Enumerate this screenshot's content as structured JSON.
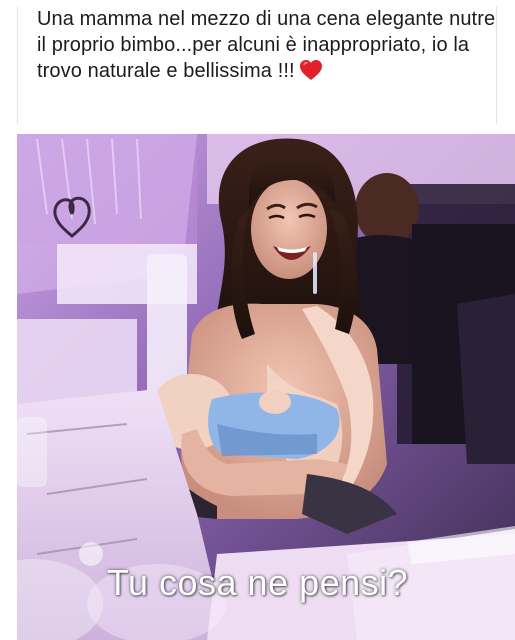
{
  "post": {
    "caption": "Una mamma nel mezzo di una cena elegante nutre il proprio bimbo...per alcuni è inappropriato, io la trovo naturale e bellissima !!!",
    "caption_emoji_icon": "red-heart-icon",
    "image_overlay_text": "Tu cosa ne pensi?"
  },
  "colors": {
    "heart": "#e0202a",
    "caption_text": "#1c1c1c",
    "overlay_text": "#ffffff"
  }
}
